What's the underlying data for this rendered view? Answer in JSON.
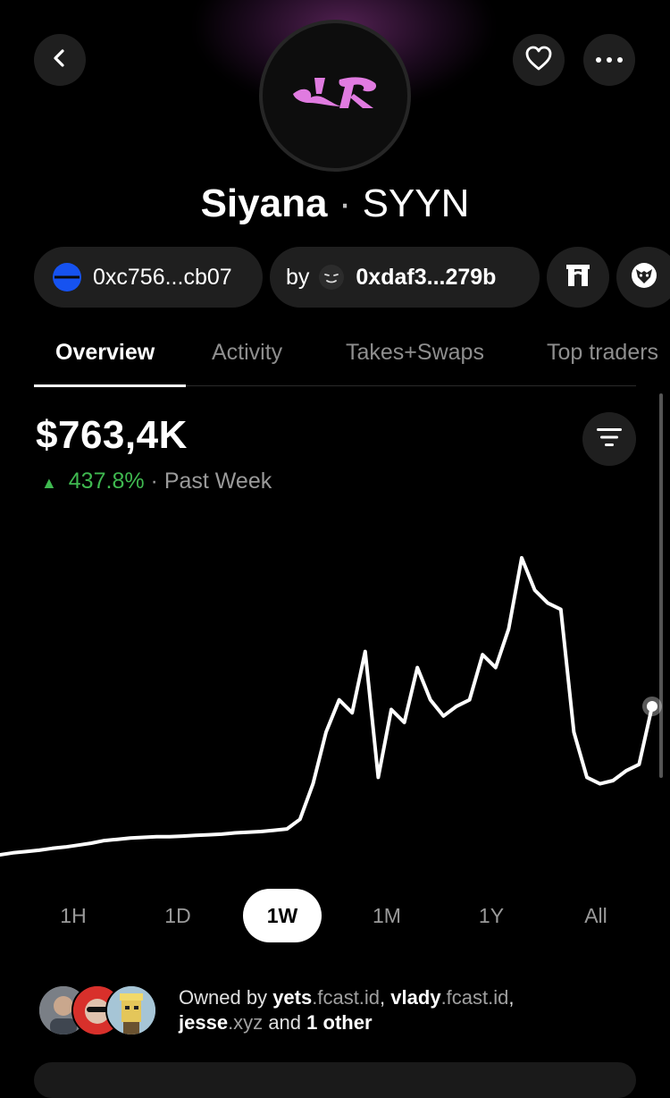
{
  "token": {
    "name": "Siyana",
    "separator": "·",
    "symbol": "SYYN"
  },
  "icons": {
    "back": "chevron-left-icon",
    "favorite": "heart-icon",
    "more": "more-horizontal-icon",
    "logo": "siyana-logo-icon",
    "base_chain": "base-chain-icon",
    "creator": "creator-face-icon",
    "gate": "gate-icon",
    "fox": "fox-icon",
    "filter": "filter-lines-icon",
    "up_arrow": "triangle-up-icon"
  },
  "chips": {
    "contract": "0xc756...cb07",
    "creator_prefix": "by",
    "creator_address": "0xdaf3...279b"
  },
  "tabs": [
    {
      "label": "Overview",
      "active": true
    },
    {
      "label": "Activity",
      "active": false
    },
    {
      "label": "Takes+Swaps",
      "active": false
    },
    {
      "label": "Top traders",
      "active": false
    }
  ],
  "stats": {
    "price": "$763,4K",
    "change_arrow": "▲",
    "change_value": "437.8%",
    "change_sep": "·",
    "change_period": "Past Week"
  },
  "chart_data": {
    "type": "line",
    "title": "",
    "xlabel": "",
    "ylabel": "",
    "grid": false,
    "x": [
      0,
      2,
      4,
      6,
      8,
      10,
      12,
      14,
      16,
      18,
      20,
      22,
      24,
      26,
      28,
      30,
      32,
      34,
      36,
      38,
      40,
      42,
      44,
      46,
      48,
      50,
      52,
      54,
      56,
      58,
      60,
      62,
      64,
      66,
      68,
      70,
      72,
      74,
      76,
      78,
      80,
      82,
      84,
      86,
      88,
      90,
      92,
      94,
      96,
      98,
      100
    ],
    "values": [
      0,
      0.3,
      0.5,
      0.7,
      1.0,
      1.2,
      1.5,
      1.8,
      2.2,
      2.4,
      2.6,
      2.7,
      2.8,
      2.8,
      2.9,
      3.0,
      3.1,
      3.2,
      3.4,
      3.5,
      3.6,
      3.8,
      4.0,
      5.5,
      11.0,
      19.0,
      24.0,
      22.0,
      31.5,
      12.0,
      22.5,
      20.5,
      29.0,
      24.0,
      21.5,
      23.0,
      24.0,
      31.0,
      29.0,
      35.0,
      46.0,
      41.0,
      39.0,
      38.0,
      19.0,
      12.0,
      11.0,
      11.5,
      13.0,
      14.0,
      23.0
    ],
    "ylim": [
      0,
      50
    ],
    "color": "#ffffff"
  },
  "ranges": [
    {
      "label": "1H",
      "active": false
    },
    {
      "label": "1D",
      "active": false
    },
    {
      "label": "1W",
      "active": true
    },
    {
      "label": "1M",
      "active": false
    },
    {
      "label": "1Y",
      "active": false
    },
    {
      "label": "All",
      "active": false
    }
  ],
  "owners": {
    "prefix": "Owned by",
    "owner1_name": "yets",
    "owner1_domain": ".fcast.id",
    "comma1": ",",
    "owner2_name": "vlady",
    "owner2_domain": ".fcast.id",
    "comma2": ",",
    "owner3_name": "jesse",
    "owner3_domain": ".xyz",
    "and": "and",
    "others": "1 other"
  },
  "colors": {
    "background": "#000000",
    "surface": "#1f1f1f",
    "positive": "#3fb950",
    "brand": "#e07be0",
    "base_blue": "#1652f0"
  }
}
